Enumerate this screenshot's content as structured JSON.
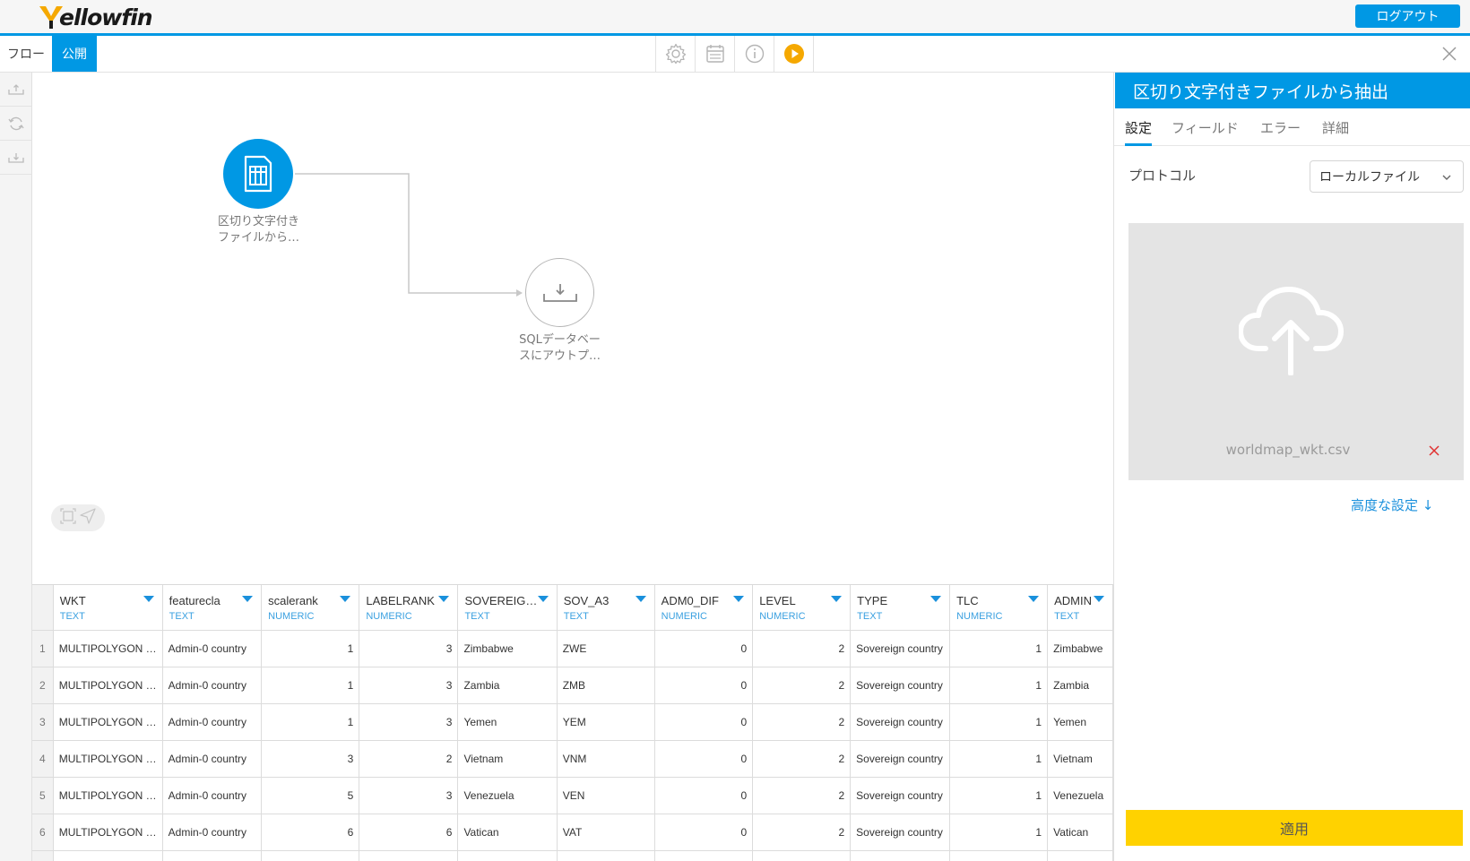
{
  "header": {
    "logo_text_main": "ellowfin",
    "logo_text_y": "Y",
    "logout_label": "ログアウト",
    "accent_color": "#0098e4"
  },
  "tabs": {
    "flow_label": "フロー",
    "publish_label": "公開"
  },
  "toolbar": {
    "icons": [
      "gear-icon",
      "calendar-icon",
      "info-icon",
      "play-icon"
    ]
  },
  "canvas": {
    "source_node": {
      "label_line1": "区切り文字付き",
      "label_line2": "ファイルから…"
    },
    "target_node": {
      "label_line1": "SQLデータベー",
      "label_line2": "スにアウトプ…"
    }
  },
  "grid": {
    "columns": [
      {
        "name": "WKT",
        "type": "TEXT"
      },
      {
        "name": "featurecla",
        "type": "TEXT"
      },
      {
        "name": "scalerank",
        "type": "NUMERIC"
      },
      {
        "name": "LABELRANK",
        "type": "NUMERIC"
      },
      {
        "name": "SOVEREIG…",
        "type": "TEXT"
      },
      {
        "name": "SOV_A3",
        "type": "TEXT"
      },
      {
        "name": "ADM0_DIF",
        "type": "NUMERIC"
      },
      {
        "name": "LEVEL",
        "type": "NUMERIC"
      },
      {
        "name": "TYPE",
        "type": "TEXT"
      },
      {
        "name": "TLC",
        "type": "NUMERIC"
      },
      {
        "name": "ADMIN",
        "type": "TEXT"
      }
    ],
    "rows": [
      [
        "1",
        "MULTIPOLYGON …",
        "Admin-0 country",
        "1",
        "3",
        "Zimbabwe",
        "ZWE",
        "0",
        "2",
        "Sovereign country",
        "1",
        "Zimbabwe"
      ],
      [
        "2",
        "MULTIPOLYGON …",
        "Admin-0 country",
        "1",
        "3",
        "Zambia",
        "ZMB",
        "0",
        "2",
        "Sovereign country",
        "1",
        "Zambia"
      ],
      [
        "3",
        "MULTIPOLYGON …",
        "Admin-0 country",
        "1",
        "3",
        "Yemen",
        "YEM",
        "0",
        "2",
        "Sovereign country",
        "1",
        "Yemen"
      ],
      [
        "4",
        "MULTIPOLYGON …",
        "Admin-0 country",
        "3",
        "2",
        "Vietnam",
        "VNM",
        "0",
        "2",
        "Sovereign country",
        "1",
        "Vietnam"
      ],
      [
        "5",
        "MULTIPOLYGON …",
        "Admin-0 country",
        "5",
        "3",
        "Venezuela",
        "VEN",
        "0",
        "2",
        "Sovereign country",
        "1",
        "Venezuela"
      ],
      [
        "6",
        "MULTIPOLYGON …",
        "Admin-0 country",
        "6",
        "6",
        "Vatican",
        "VAT",
        "0",
        "2",
        "Sovereign country",
        "1",
        "Vatican"
      ],
      [
        "",
        "",
        "",
        "",
        "",
        "",
        "",
        "",
        "",
        "",
        "",
        ""
      ]
    ]
  },
  "panel": {
    "title": "区切り文字付きファイルから抽出",
    "tabs": [
      "設定",
      "フィールド",
      "エラー",
      "詳細"
    ],
    "protocol_label": "プロトコル",
    "protocol_value": "ローカルファイル",
    "file_name": "worldmap_wkt.csv",
    "advanced_label": "高度な設定 ↓",
    "apply_label": "適用",
    "apply_color": "#ffd200"
  }
}
